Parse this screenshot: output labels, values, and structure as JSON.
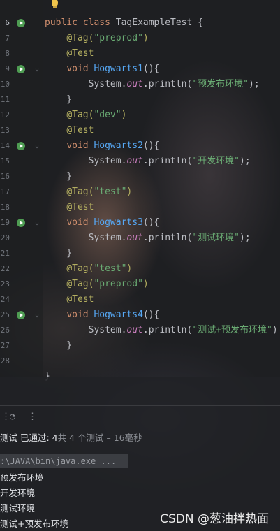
{
  "editor": {
    "lines": [
      {
        "no": "6",
        "active": true,
        "run": true,
        "fold": "",
        "parts": [
          {
            "t": "public ",
            "c": "kw"
          },
          {
            "t": "class ",
            "c": "kw"
          },
          {
            "t": "TagExampleTest {",
            "c": ""
          }
        ]
      },
      {
        "no": "7",
        "parts": [
          {
            "t": "    ",
            "c": ""
          },
          {
            "t": "@Tag(",
            "c": "ann"
          },
          {
            "t": "\"preprod\"",
            "c": "str"
          },
          {
            "t": ")",
            "c": "ann"
          }
        ]
      },
      {
        "no": "8",
        "parts": [
          {
            "t": "    ",
            "c": ""
          },
          {
            "t": "@Test",
            "c": "ann"
          }
        ]
      },
      {
        "no": "9",
        "run": true,
        "fold": "⌄",
        "parts": [
          {
            "t": "    ",
            "c": ""
          },
          {
            "t": "void ",
            "c": "kw"
          },
          {
            "t": "Hogwarts1",
            "c": "meth"
          },
          {
            "t": "(){",
            "c": ""
          }
        ]
      },
      {
        "no": "10",
        "parts": [
          {
            "t": "        System.",
            "c": ""
          },
          {
            "t": "out",
            "c": "fld"
          },
          {
            "t": ".println(",
            "c": ""
          },
          {
            "t": "\"预发布环境\"",
            "c": "str"
          },
          {
            "t": ");",
            "c": ""
          }
        ]
      },
      {
        "no": "11",
        "parts": [
          {
            "t": "    }",
            "c": ""
          }
        ]
      },
      {
        "no": "12",
        "parts": [
          {
            "t": "    ",
            "c": ""
          },
          {
            "t": "@Tag(",
            "c": "ann"
          },
          {
            "t": "\"dev\"",
            "c": "str"
          },
          {
            "t": ")",
            "c": "ann"
          }
        ]
      },
      {
        "no": "13",
        "parts": [
          {
            "t": "    ",
            "c": ""
          },
          {
            "t": "@Test",
            "c": "ann"
          }
        ]
      },
      {
        "no": "14",
        "run": true,
        "fold": "⌄",
        "parts": [
          {
            "t": "    ",
            "c": ""
          },
          {
            "t": "void ",
            "c": "kw"
          },
          {
            "t": "Hogwarts2",
            "c": "meth"
          },
          {
            "t": "(){",
            "c": ""
          }
        ]
      },
      {
        "no": "15",
        "parts": [
          {
            "t": "        System.",
            "c": ""
          },
          {
            "t": "out",
            "c": "fld"
          },
          {
            "t": ".println(",
            "c": ""
          },
          {
            "t": "\"开发环境\"",
            "c": "str"
          },
          {
            "t": ");",
            "c": ""
          }
        ]
      },
      {
        "no": "16",
        "parts": [
          {
            "t": "    }",
            "c": ""
          }
        ]
      },
      {
        "no": "17",
        "parts": [
          {
            "t": "    ",
            "c": ""
          },
          {
            "t": "@Tag(",
            "c": "ann"
          },
          {
            "t": "\"test\"",
            "c": "str"
          },
          {
            "t": ")",
            "c": "ann"
          }
        ]
      },
      {
        "no": "18",
        "parts": [
          {
            "t": "    ",
            "c": ""
          },
          {
            "t": "@Test",
            "c": "ann"
          }
        ]
      },
      {
        "no": "19",
        "run": true,
        "fold": "⌄",
        "parts": [
          {
            "t": "    ",
            "c": ""
          },
          {
            "t": "void ",
            "c": "kw"
          },
          {
            "t": "Hogwarts3",
            "c": "meth"
          },
          {
            "t": "(){",
            "c": ""
          }
        ]
      },
      {
        "no": "20",
        "parts": [
          {
            "t": "        System.",
            "c": ""
          },
          {
            "t": "out",
            "c": "fld"
          },
          {
            "t": ".println(",
            "c": ""
          },
          {
            "t": "\"测试环境\"",
            "c": "str"
          },
          {
            "t": ");",
            "c": ""
          }
        ]
      },
      {
        "no": "21",
        "parts": [
          {
            "t": "    }",
            "c": ""
          }
        ]
      },
      {
        "no": "22",
        "parts": [
          {
            "t": "    ",
            "c": ""
          },
          {
            "t": "@Tag(",
            "c": "ann"
          },
          {
            "t": "\"test\"",
            "c": "str"
          },
          {
            "t": ")",
            "c": "ann"
          }
        ]
      },
      {
        "no": "23",
        "parts": [
          {
            "t": "    ",
            "c": ""
          },
          {
            "t": "@Tag(",
            "c": "ann"
          },
          {
            "t": "\"preprod\"",
            "c": "str"
          },
          {
            "t": ")",
            "c": "ann"
          }
        ]
      },
      {
        "no": "24",
        "parts": [
          {
            "t": "    ",
            "c": ""
          },
          {
            "t": "@Test",
            "c": "ann"
          }
        ]
      },
      {
        "no": "25",
        "run": true,
        "fold": "⌄",
        "parts": [
          {
            "t": "    ",
            "c": ""
          },
          {
            "t": "void ",
            "c": "kw"
          },
          {
            "t": "Hogwarts4",
            "c": "meth"
          },
          {
            "t": "(){",
            "c": ""
          }
        ]
      },
      {
        "no": "26",
        "parts": [
          {
            "t": "        System.",
            "c": ""
          },
          {
            "t": "out",
            "c": "fld"
          },
          {
            "t": ".println(",
            "c": ""
          },
          {
            "t": "\"测试+预发布环境\"",
            "c": "str"
          },
          {
            "t": ")",
            "c": ""
          }
        ]
      },
      {
        "no": "27",
        "parts": [
          {
            "t": "    }",
            "c": ""
          }
        ]
      },
      {
        "no": "28",
        "parts": []
      },
      {
        "no": "",
        "parts": [
          {
            "t": "}",
            "c": ""
          }
        ]
      }
    ]
  },
  "run_panel": {
    "summary_label": "测试 已通过: ",
    "summary_count": "4",
    "summary_rest": "共 4 个测试 – 16毫秒",
    "command": ":\\JAVA\\bin\\java.exe ...",
    "output": [
      "预发布环境",
      "开发环境",
      "测试环境",
      "测试+预发布环境"
    ]
  },
  "watermark": "CSDN @葱油拌热面",
  "icons": {
    "run": "run-test-icon",
    "bulb": "bulb-icon",
    "fold": "fold-chevron-icon"
  }
}
